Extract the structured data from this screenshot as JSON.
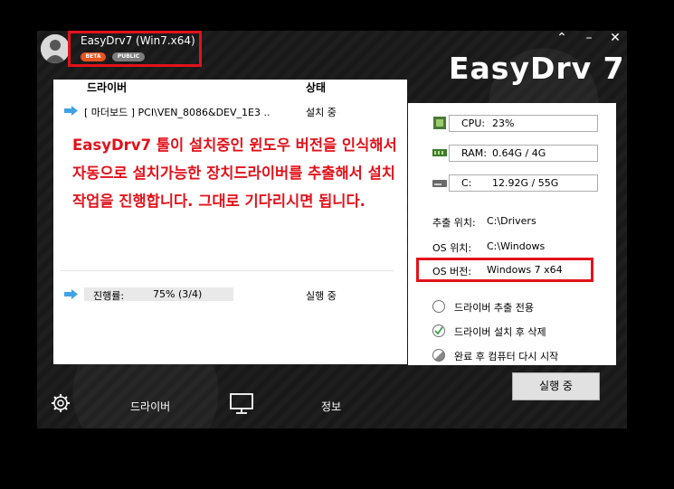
{
  "window": {
    "title": "EasyDrv7 (Win7.x64)",
    "badges": [
      "BETA",
      "PUBLIC"
    ],
    "logo": "EasyDrv 7",
    "accent": "#e2121b"
  },
  "window_controls": {
    "pin": "⌃",
    "minimize": "–",
    "close": "✕"
  },
  "driver_list": {
    "headers": {
      "driver": "드라이버",
      "status": "상태"
    },
    "rows": [
      {
        "name": "[ 마더보드 ] PCI\\VEN_8086&DEV_1E3 ..",
        "status": "설치 중"
      }
    ]
  },
  "notice": "EasyDrv7 툴이 설치중인 윈도우 버전을 인식해서 자동으로 설치가능한 장치드라이버를 추출해서 설치작업을 진행합니다. 그대로 기다리시면 됩니다.",
  "progress": {
    "label": "진행률:",
    "value": "75% (3/4)",
    "fraction": 0.75,
    "status": "실행 중"
  },
  "resources": {
    "cpu": {
      "label": "CPU:",
      "value": "23%"
    },
    "ram": {
      "label": "RAM:",
      "value": "0.64G / 4G"
    },
    "disk": {
      "label": "C:",
      "value": "12.92G / 55G"
    }
  },
  "info": {
    "extract_path": {
      "label": "추출 위치:",
      "value": "C:\\Drivers"
    },
    "os_path": {
      "label": "OS 위치:",
      "value": "C:\\Windows"
    },
    "os_version": {
      "label": "OS 버전:",
      "value": "Windows 7 x64"
    }
  },
  "options": [
    {
      "label": "드라이버 추출 전용",
      "checked": false
    },
    {
      "label": "드라이버 설치 후 삭제",
      "checked": true
    },
    {
      "label": "완료 후 컴퓨터 다시 시작",
      "checked": false,
      "half": true
    }
  ],
  "action_button": "실행 중",
  "bottom_nav": {
    "drivers": "드라이버",
    "info": "정보"
  }
}
